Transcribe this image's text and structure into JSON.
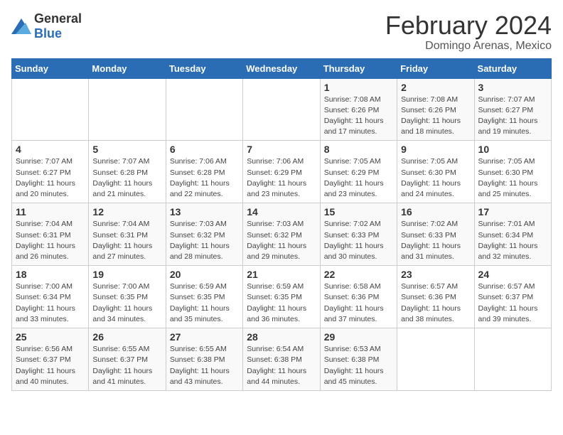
{
  "logo": {
    "general": "General",
    "blue": "Blue"
  },
  "title": "February 2024",
  "subtitle": "Domingo Arenas, Mexico",
  "days_of_week": [
    "Sunday",
    "Monday",
    "Tuesday",
    "Wednesday",
    "Thursday",
    "Friday",
    "Saturday"
  ],
  "weeks": [
    [
      {
        "day": "",
        "info": ""
      },
      {
        "day": "",
        "info": ""
      },
      {
        "day": "",
        "info": ""
      },
      {
        "day": "",
        "info": ""
      },
      {
        "day": "1",
        "info": "Sunrise: 7:08 AM\nSunset: 6:26 PM\nDaylight: 11 hours and 17 minutes."
      },
      {
        "day": "2",
        "info": "Sunrise: 7:08 AM\nSunset: 6:26 PM\nDaylight: 11 hours and 18 minutes."
      },
      {
        "day": "3",
        "info": "Sunrise: 7:07 AM\nSunset: 6:27 PM\nDaylight: 11 hours and 19 minutes."
      }
    ],
    [
      {
        "day": "4",
        "info": "Sunrise: 7:07 AM\nSunset: 6:27 PM\nDaylight: 11 hours and 20 minutes."
      },
      {
        "day": "5",
        "info": "Sunrise: 7:07 AM\nSunset: 6:28 PM\nDaylight: 11 hours and 21 minutes."
      },
      {
        "day": "6",
        "info": "Sunrise: 7:06 AM\nSunset: 6:28 PM\nDaylight: 11 hours and 22 minutes."
      },
      {
        "day": "7",
        "info": "Sunrise: 7:06 AM\nSunset: 6:29 PM\nDaylight: 11 hours and 23 minutes."
      },
      {
        "day": "8",
        "info": "Sunrise: 7:05 AM\nSunset: 6:29 PM\nDaylight: 11 hours and 23 minutes."
      },
      {
        "day": "9",
        "info": "Sunrise: 7:05 AM\nSunset: 6:30 PM\nDaylight: 11 hours and 24 minutes."
      },
      {
        "day": "10",
        "info": "Sunrise: 7:05 AM\nSunset: 6:30 PM\nDaylight: 11 hours and 25 minutes."
      }
    ],
    [
      {
        "day": "11",
        "info": "Sunrise: 7:04 AM\nSunset: 6:31 PM\nDaylight: 11 hours and 26 minutes."
      },
      {
        "day": "12",
        "info": "Sunrise: 7:04 AM\nSunset: 6:31 PM\nDaylight: 11 hours and 27 minutes."
      },
      {
        "day": "13",
        "info": "Sunrise: 7:03 AM\nSunset: 6:32 PM\nDaylight: 11 hours and 28 minutes."
      },
      {
        "day": "14",
        "info": "Sunrise: 7:03 AM\nSunset: 6:32 PM\nDaylight: 11 hours and 29 minutes."
      },
      {
        "day": "15",
        "info": "Sunrise: 7:02 AM\nSunset: 6:33 PM\nDaylight: 11 hours and 30 minutes."
      },
      {
        "day": "16",
        "info": "Sunrise: 7:02 AM\nSunset: 6:33 PM\nDaylight: 11 hours and 31 minutes."
      },
      {
        "day": "17",
        "info": "Sunrise: 7:01 AM\nSunset: 6:34 PM\nDaylight: 11 hours and 32 minutes."
      }
    ],
    [
      {
        "day": "18",
        "info": "Sunrise: 7:00 AM\nSunset: 6:34 PM\nDaylight: 11 hours and 33 minutes."
      },
      {
        "day": "19",
        "info": "Sunrise: 7:00 AM\nSunset: 6:35 PM\nDaylight: 11 hours and 34 minutes."
      },
      {
        "day": "20",
        "info": "Sunrise: 6:59 AM\nSunset: 6:35 PM\nDaylight: 11 hours and 35 minutes."
      },
      {
        "day": "21",
        "info": "Sunrise: 6:59 AM\nSunset: 6:35 PM\nDaylight: 11 hours and 36 minutes."
      },
      {
        "day": "22",
        "info": "Sunrise: 6:58 AM\nSunset: 6:36 PM\nDaylight: 11 hours and 37 minutes."
      },
      {
        "day": "23",
        "info": "Sunrise: 6:57 AM\nSunset: 6:36 PM\nDaylight: 11 hours and 38 minutes."
      },
      {
        "day": "24",
        "info": "Sunrise: 6:57 AM\nSunset: 6:37 PM\nDaylight: 11 hours and 39 minutes."
      }
    ],
    [
      {
        "day": "25",
        "info": "Sunrise: 6:56 AM\nSunset: 6:37 PM\nDaylight: 11 hours and 40 minutes."
      },
      {
        "day": "26",
        "info": "Sunrise: 6:55 AM\nSunset: 6:37 PM\nDaylight: 11 hours and 41 minutes."
      },
      {
        "day": "27",
        "info": "Sunrise: 6:55 AM\nSunset: 6:38 PM\nDaylight: 11 hours and 43 minutes."
      },
      {
        "day": "28",
        "info": "Sunrise: 6:54 AM\nSunset: 6:38 PM\nDaylight: 11 hours and 44 minutes."
      },
      {
        "day": "29",
        "info": "Sunrise: 6:53 AM\nSunset: 6:38 PM\nDaylight: 11 hours and 45 minutes."
      },
      {
        "day": "",
        "info": ""
      },
      {
        "day": "",
        "info": ""
      }
    ]
  ]
}
